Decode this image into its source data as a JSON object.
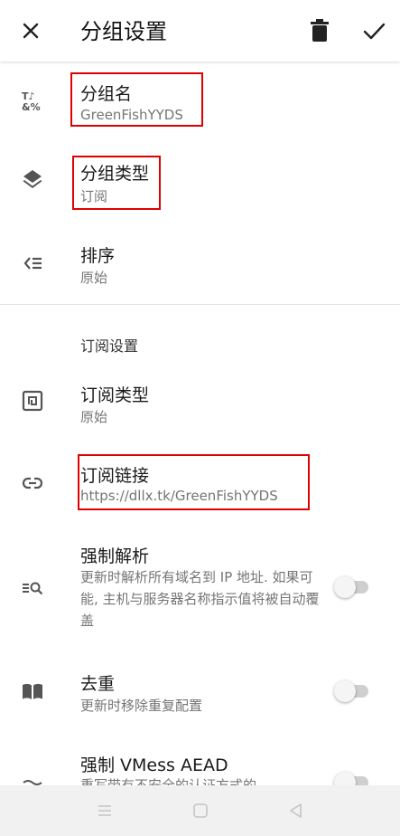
{
  "appbar": {
    "title": "分组设置"
  },
  "rows": {
    "group_name": {
      "title": "分组名",
      "subtitle": "GreenFishYYDS"
    },
    "group_type": {
      "title": "分组类型",
      "subtitle": "订阅"
    },
    "sort": {
      "title": "排序",
      "subtitle": "原始"
    },
    "sub_type": {
      "title": "订阅类型",
      "subtitle": "原始"
    },
    "sub_link": {
      "title": "订阅链接",
      "subtitle": "https://dllx.tk/GreenFishYYDS"
    },
    "force_resolve": {
      "title": "强制解析",
      "subtitle": "更新时解析所有域名到 IP 地址. 如果可能, 主机与服务器名称指示值将被自动覆盖",
      "enabled": false
    },
    "dedupe": {
      "title": "去重",
      "subtitle": "更新时移除重复配置",
      "enabled": false
    },
    "vmess_aead": {
      "title": "强制 VMess AEAD",
      "subtitle": "重写带有不安全的认证方式的",
      "enabled": false
    }
  },
  "section": {
    "subscription_settings": "订阅设置"
  },
  "icons": {
    "close": "close-icon",
    "delete": "trash-icon",
    "confirm": "check-icon",
    "group_name": "text-format-icon",
    "group_type": "layers-icon",
    "sort": "sort-icon",
    "sub_type": "nfc-icon",
    "sub_link": "link-icon",
    "force_resolve": "search-list-icon",
    "dedupe": "book-icon",
    "vmess_aead": "waves-icon"
  },
  "colors": {
    "highlight": "#e00000",
    "toggle_off": "#cfcfcf"
  }
}
